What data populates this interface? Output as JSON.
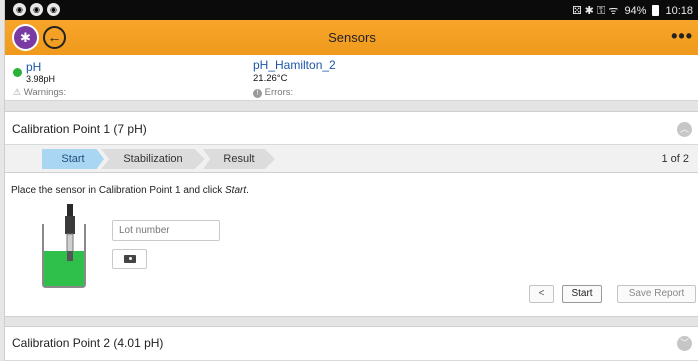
{
  "status_bar": {
    "left_icons": [
      "app-notification-icon",
      "app-notification-icon",
      "app-notification-icon"
    ],
    "indicators": "⚄ ✱ ⚿ ᯤ",
    "battery": "94%",
    "time": "10:18"
  },
  "app_bar": {
    "title": "Sensors",
    "more_label": "•••"
  },
  "sensor_summary": {
    "name": "pH",
    "value": "3.98pH",
    "warnings_label": "Warnings:",
    "sensor_id": "pH_Hamilton_2",
    "temperature": "21.26°C",
    "errors_label": "Errors:",
    "status_color": "#2bb13a"
  },
  "calibration_point_1": {
    "title": "Calibration Point 1 (7 pH)",
    "steps": [
      "Start",
      "Stabilization",
      "Result"
    ],
    "active_step": "Start",
    "page_count": "1 of 2",
    "instruction_prefix": "Place the sensor in Calibration Point 1 and click ",
    "instruction_action": "Start",
    "instruction_suffix": ".",
    "lot_placeholder": "Lot number",
    "buttons": {
      "prev": "<",
      "start": "Start",
      "save": "Save Report"
    }
  },
  "calibration_point_2": {
    "title": "Calibration Point 2 (4.01 pH)"
  },
  "colors": {
    "app_bar": "#f5a623",
    "active_step": "#a9d7f3",
    "link": "#1c57a8"
  }
}
